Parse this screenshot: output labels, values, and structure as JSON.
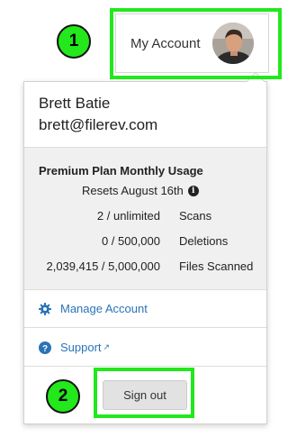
{
  "account_button": {
    "label": "My Account"
  },
  "step_markers": {
    "first": "1",
    "second": "2"
  },
  "user": {
    "name": "Brett Batie",
    "email": "brett@filerev.com"
  },
  "usage": {
    "title": "Premium Plan Monthly Usage",
    "resets": "Resets August 16th",
    "rows": [
      {
        "value": "2 / unlimited",
        "label": "Scans"
      },
      {
        "value": "0 / 500,000",
        "label": "Deletions"
      },
      {
        "value": "2,039,415 / 5,000,000",
        "label": "Files Scanned"
      }
    ]
  },
  "menu": {
    "manage_account": "Manage Account",
    "support": "Support"
  },
  "sign_out_label": "Sign out",
  "colors": {
    "highlight": "#22e81c",
    "link": "#2a73b8",
    "usage_background": "#f0f0f0"
  }
}
